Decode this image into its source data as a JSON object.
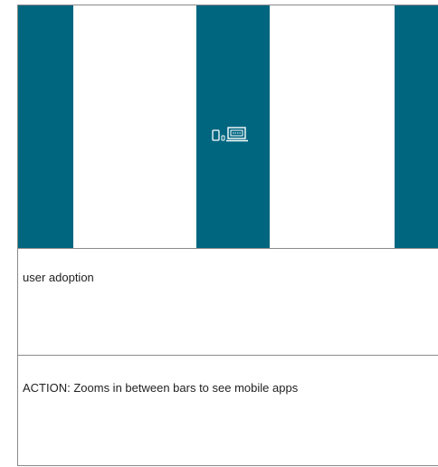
{
  "storyboard": {
    "bar_color": "#006680",
    "icons": [
      "tablet-icon",
      "phone-icon",
      "laptop-icon"
    ]
  },
  "captions": {
    "label": "user adoption",
    "action": "ACTION: Zooms in between bars to see mobile apps"
  }
}
